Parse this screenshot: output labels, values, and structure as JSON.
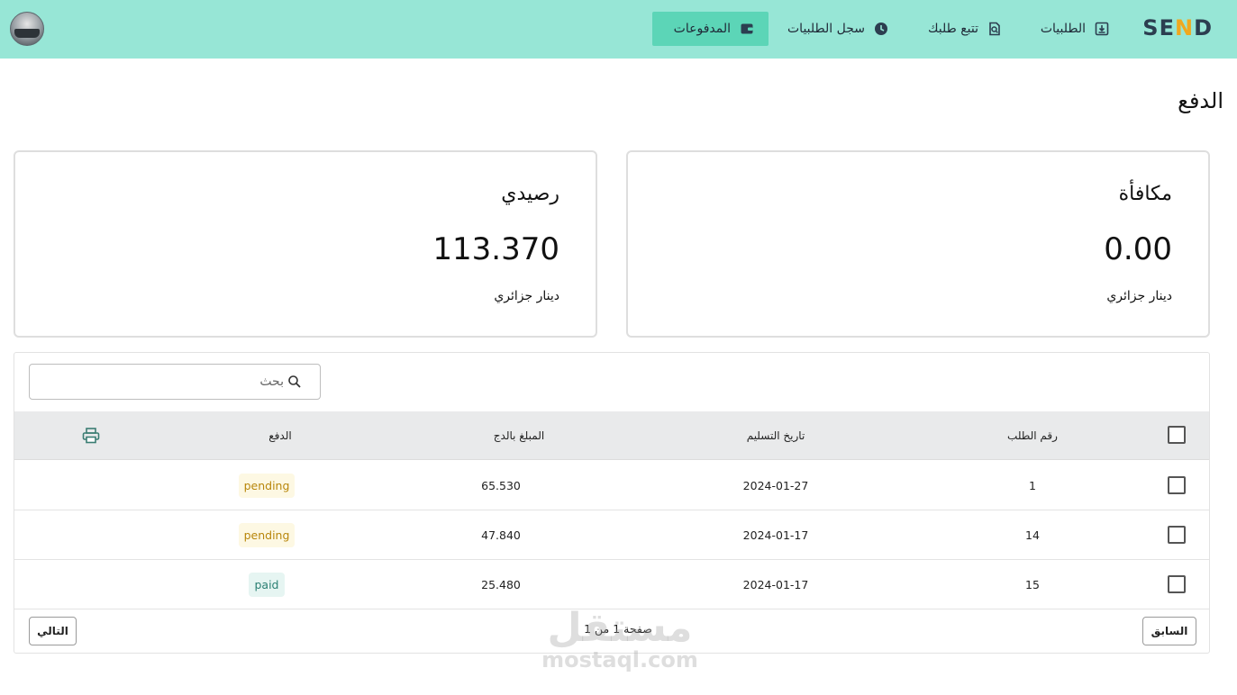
{
  "header": {
    "logo_text_a": "SE",
    "logo_text_b": "N",
    "logo_text_c": "D",
    "nav": [
      {
        "label": "الطلبيات",
        "icon": "download-box-icon"
      },
      {
        "label": "تتبع طلبك",
        "icon": "search-document-icon"
      },
      {
        "label": "سجل الطلبيات",
        "icon": "clock-icon"
      },
      {
        "label": "المدفوعات",
        "icon": "wallet-icon",
        "active": true
      }
    ]
  },
  "page": {
    "title": "الدفع"
  },
  "cards": {
    "reward": {
      "title": "مكافأة",
      "value": "0.00",
      "unit": "دينار جزائري"
    },
    "balance": {
      "title": "رصيدي",
      "value": "113.370",
      "unit": "دينار جزائري"
    }
  },
  "search": {
    "placeholder": "بحث"
  },
  "table": {
    "headers": {
      "order_no": "رقم الطلب",
      "delivery_date": "تاريخ التسليم",
      "amount": "المبلغ بالدج",
      "payment": "الدفع"
    },
    "rows": [
      {
        "order_no": "1",
        "delivery_date": "2024-01-27",
        "amount": "65.530",
        "payment": "pending"
      },
      {
        "order_no": "14",
        "delivery_date": "2024-01-17",
        "amount": "47.840",
        "payment": "pending"
      },
      {
        "order_no": "15",
        "delivery_date": "2024-01-17",
        "amount": "25.480",
        "payment": "paid"
      }
    ]
  },
  "pagination": {
    "prev": "السابق",
    "next": "التالي",
    "info": "صفحة 1 من 1"
  },
  "watermark": {
    "ar": "مستقل",
    "en": "mostaql.com"
  },
  "colors": {
    "header_bg": "#97e6d6",
    "active_nav": "#5cd5b7",
    "pending": "#b8860b",
    "paid": "#2a7f73"
  }
}
